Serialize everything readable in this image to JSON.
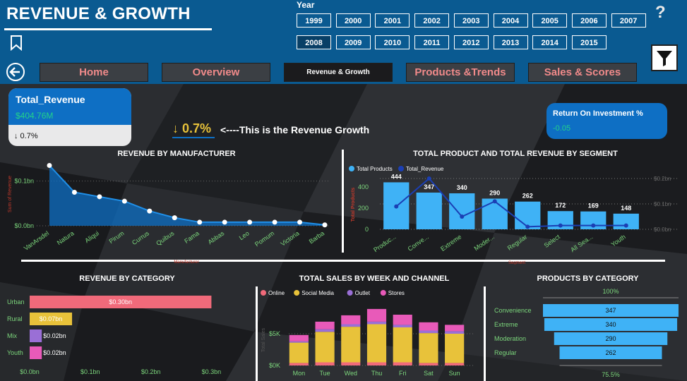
{
  "header": {
    "title": "REVENUE & GROWTH",
    "year_label": "Year",
    "years_row1": [
      "1999",
      "2000",
      "2001",
      "2002",
      "2003",
      "2004",
      "2005",
      "2006",
      "2007"
    ],
    "years_row2": [
      "2008",
      "2009",
      "2010",
      "2011",
      "2012",
      "2013",
      "2014",
      "2015"
    ],
    "selected_year": "2008",
    "help_symbol": "?"
  },
  "nav": {
    "tabs": [
      {
        "label": "Home",
        "active": false
      },
      {
        "label": "Overview",
        "active": false
      },
      {
        "label": "Revenue & Growth",
        "active": true
      },
      {
        "label": "Products &Trends",
        "active": false
      },
      {
        "label": "Sales & Scores",
        "active": false
      }
    ]
  },
  "kpi": {
    "total_revenue_label": "Total_Revenue",
    "total_revenue_value": "$404.76M",
    "total_revenue_change": "↓ 0.7%",
    "growth_value": "↓ 0.7%",
    "growth_caption": "<----This is the Revenue Growth",
    "roi_label": "Return On Investment %",
    "roi_value": "-0.05"
  },
  "colors": {
    "header_blue": "#0a5a91",
    "card_blue": "#0e6fc4",
    "accent_green": "#22d28a",
    "bar_blue": "#3fb2f6",
    "line_dark": "#1b3fb4",
    "pink": "#f06a7a",
    "gold": "#e8c23a",
    "purple": "#9a6fd6",
    "magenta": "#e85ab9",
    "red_label": "#c0392b"
  },
  "chart_data": [
    {
      "type": "area",
      "title": "REVENUE BY MANUFACTURER",
      "xlabel": "Manufacturer",
      "ylabel": "Sum of Revenue",
      "categories": [
        "VanArsdel",
        "Natura",
        "Aliqui",
        "Pirum",
        "Currus",
        "Quibus",
        "Fama",
        "Abbas",
        "Leo",
        "Pomum",
        "Victoria",
        "Barba"
      ],
      "values": [
        0.135,
        0.075,
        0.065,
        0.055,
        0.033,
        0.018,
        0.008,
        0.008,
        0.008,
        0.008,
        0.008,
        0.002
      ],
      "yticks": [
        "$0.0bn",
        "$0.1bn"
      ],
      "ylim": [
        0,
        0.15
      ]
    },
    {
      "type": "bar",
      "title": "TOTAL PRODUCT AND TOTAL REVENUE BY SEGMENT",
      "xlabel": "Segment",
      "ylabel": "Total Products",
      "legend": [
        "Total Products",
        "Total_Revenue"
      ],
      "categories": [
        "Produc...",
        "Conve...",
        "Extreme",
        "Moder...",
        "Regular",
        "Select",
        "All Sea...",
        "Youth"
      ],
      "values": [
        444,
        347,
        340,
        290,
        262,
        172,
        169,
        148
      ],
      "value_labels": [
        "444",
        "347",
        "340",
        "290",
        "262",
        "172",
        "169",
        "148"
      ],
      "line_values": [
        0.09,
        0.2,
        0.05,
        0.11,
        0.01,
        0.015,
        0.015,
        0.015
      ],
      "yticks": [
        "0",
        "200",
        "400"
      ],
      "right_ticks": [
        "$0.2bn",
        "$0.1bn",
        "$0.0bn"
      ],
      "ylim": [
        0,
        600
      ]
    },
    {
      "type": "bar",
      "title": "REVENUE BY CATEGORY",
      "categories": [
        "Urban",
        "Rural",
        "Mix",
        "Youth"
      ],
      "values": [
        0.3,
        0.07,
        0.02,
        0.02
      ],
      "value_labels": [
        "$0.30bn",
        "$0.07bn",
        "$0.02bn",
        "$0.02bn"
      ],
      "xticks": [
        "$0.0bn",
        "$0.1bn",
        "$0.2bn",
        "$0.3bn"
      ],
      "xlim": [
        0,
        0.31
      ]
    },
    {
      "type": "bar",
      "title": "TOTAL SALES BY WEEK AND CHANNEL",
      "ylabel": "Total Sales",
      "categories": [
        "Mon",
        "Tue",
        "Wed",
        "Thu",
        "Fri",
        "Sat",
        "Sun"
      ],
      "series": [
        {
          "name": "Online",
          "values": [
            0.4,
            0.5,
            0.5,
            0.5,
            0.5,
            0.4,
            0.4
          ]
        },
        {
          "name": "Social Media",
          "values": [
            3.2,
            4.8,
            5.6,
            6.0,
            5.5,
            4.7,
            4.6
          ]
        },
        {
          "name": "Outlet",
          "values": [
            0.2,
            0.4,
            0.4,
            0.4,
            0.4,
            0.4,
            0.4
          ]
        },
        {
          "name": "Stores",
          "values": [
            1.0,
            1.2,
            1.4,
            2.0,
            1.6,
            1.3,
            1.0
          ]
        }
      ],
      "yticks": [
        "$0K",
        "$5K"
      ],
      "ylim": [
        0,
        10
      ]
    },
    {
      "type": "bar",
      "title": "PRODUCTS BY CATEGORY",
      "top_label": "100%",
      "bottom_label": "75.5%",
      "categories": [
        "Convenience",
        "Extreme",
        "Moderation",
        "Regular"
      ],
      "values": [
        347,
        340,
        290,
        262
      ],
      "value_labels": [
        "347",
        "340",
        "290",
        "262"
      ]
    }
  ]
}
